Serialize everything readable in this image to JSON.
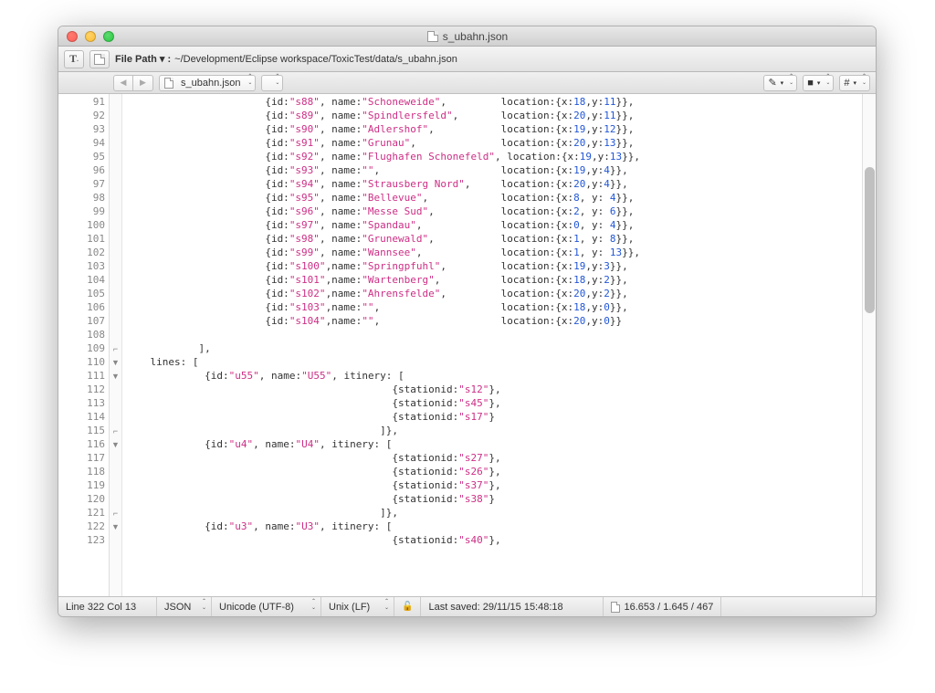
{
  "window": {
    "title": "s_ubahn.json"
  },
  "toolbar": {
    "filepath_label": "File Path ▾ :",
    "filepath": "~/Development/Eclipse workspace/ToxicTest/data/s_ubahn.json"
  },
  "tabbar": {
    "filename": "s_ubahn.json"
  },
  "gutter": {
    "start": 91,
    "end": 123
  },
  "fold_markers": {
    "109": "⌐",
    "110": "▼",
    "111": "▼",
    "115": "⌐",
    "116": "▼",
    "121": "⌐",
    "122": "▼"
  },
  "code_rows": [
    {
      "id": "s88",
      "name": "Schoneweide",
      "x": 18,
      "y": 11,
      "tail": "},"
    },
    {
      "id": "s89",
      "name": "Spindlersfeld",
      "x": 20,
      "y": 11,
      "tail": "},"
    },
    {
      "id": "s90",
      "name": "Adlershof",
      "x": 19,
      "y": 12,
      "tail": "},"
    },
    {
      "id": "s91",
      "name": "Grunau",
      "x": 20,
      "y": 13,
      "tail": "},"
    },
    {
      "id": "s92",
      "name": "Flughafen Schonefeld",
      "x": 19,
      "y": 13,
      "tail": "},"
    },
    {
      "id": "s93",
      "name": "",
      "x": 19,
      "y": 4,
      "tail": "},"
    },
    {
      "id": "s94",
      "name": "Strausberg Nord",
      "x": 20,
      "y": 4,
      "tail": "},"
    },
    {
      "id": "s95",
      "name": "Bellevue",
      "x": 8,
      "y": 4,
      "pad": true,
      "tail": "},"
    },
    {
      "id": "s96",
      "name": "Messe Sud",
      "x": 2,
      "y": 6,
      "pad": true,
      "tail": "},"
    },
    {
      "id": "s97",
      "name": "Spandau",
      "x": 0,
      "y": 4,
      "pad": true,
      "tail": "},"
    },
    {
      "id": "s98",
      "name": "Grunewald",
      "x": 1,
      "y": 8,
      "pad": true,
      "tail": "},"
    },
    {
      "id": "s99",
      "name": "Wannsee",
      "x": 1,
      "y": 13,
      "pad": true,
      "tail": "},"
    },
    {
      "id": "s100",
      "name": "Springpfuhl",
      "x": 19,
      "y": 3,
      "nosp": true,
      "tail": "},"
    },
    {
      "id": "s101",
      "name": "Wartenberg",
      "x": 18,
      "y": 2,
      "nosp": true,
      "tail": "},"
    },
    {
      "id": "s102",
      "name": "Ahrensfelde",
      "x": 20,
      "y": 2,
      "nosp": true,
      "tail": "},"
    },
    {
      "id": "s103",
      "name": "",
      "x": 18,
      "y": 0,
      "nosp": true,
      "tail": "},"
    },
    {
      "id": "s104",
      "name": "",
      "x": 20,
      "y": 0,
      "nosp": true,
      "tail": "}"
    }
  ],
  "lines_block": {
    "close_array": "            ],",
    "lines_open": "    lines: [",
    "u55_open": {
      "indent": "             ",
      "id": "u55",
      "name": "U55"
    },
    "u55_stations": [
      "s12",
      "s45",
      "s17"
    ],
    "itin_close": "                                          ]},",
    "u4_open": {
      "indent": "             ",
      "id": "u4",
      "name": "U4"
    },
    "u4_stations": [
      "s27",
      "s26",
      "s37",
      "s38"
    ],
    "u3_open": {
      "indent": "             ",
      "id": "u3",
      "name": "U3"
    },
    "u3_stations": [
      "s40"
    ]
  },
  "statusbar": {
    "pos": "Line 322 Col 13",
    "lang": "JSON",
    "encoding": "Unicode (UTF-8)",
    "lineend": "Unix (LF)",
    "saved": "Last saved: 29/11/15 15:48:18",
    "counts": "16.653 / 1.645 / 467"
  }
}
